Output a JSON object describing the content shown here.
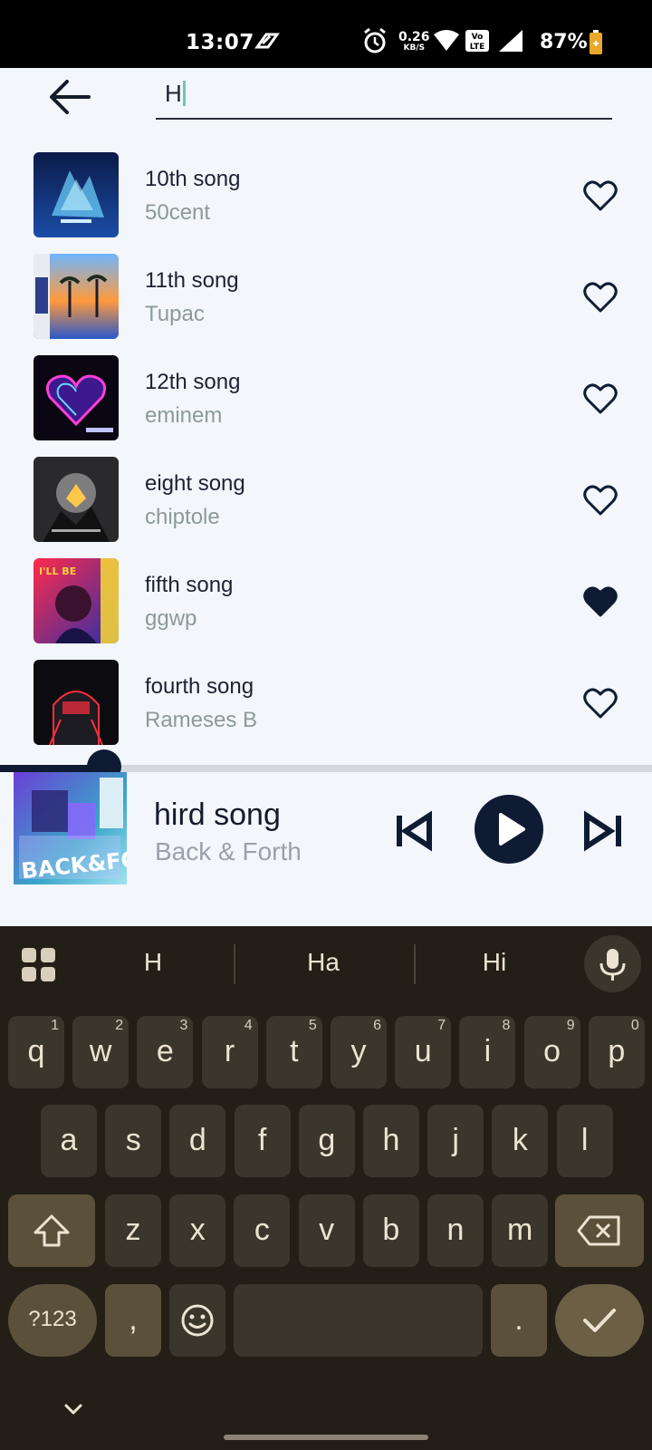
{
  "status_bar": {
    "time": "13:07",
    "net_speed_value": "0.26",
    "net_speed_unit": "KB/S",
    "battery": "87%"
  },
  "search": {
    "query": "H"
  },
  "songs": [
    {
      "title": "10th song",
      "artist": "50cent",
      "liked": false
    },
    {
      "title": "11th song",
      "artist": "Tupac",
      "liked": false
    },
    {
      "title": "12th song",
      "artist": "eminem",
      "liked": false
    },
    {
      "title": "eight song",
      "artist": "chiptole",
      "liked": false
    },
    {
      "title": "fifth song",
      "artist": "ggwp",
      "liked": true
    },
    {
      "title": "fourth song",
      "artist": "Rameses B",
      "liked": false
    }
  ],
  "player": {
    "title": "hird song",
    "artist": "Back & Forth",
    "progress": 0.16
  },
  "keyboard": {
    "suggestions": [
      "H",
      "Ha",
      "Hi"
    ],
    "row1": [
      {
        "k": "q",
        "n": "1"
      },
      {
        "k": "w",
        "n": "2"
      },
      {
        "k": "e",
        "n": "3"
      },
      {
        "k": "r",
        "n": "4"
      },
      {
        "k": "t",
        "n": "5"
      },
      {
        "k": "y",
        "n": "6"
      },
      {
        "k": "u",
        "n": "7"
      },
      {
        "k": "i",
        "n": "8"
      },
      {
        "k": "o",
        "n": "9"
      },
      {
        "k": "p",
        "n": "0"
      }
    ],
    "row2": [
      "a",
      "s",
      "d",
      "f",
      "g",
      "h",
      "j",
      "k",
      "l"
    ],
    "row3": [
      "z",
      "x",
      "c",
      "v",
      "b",
      "n",
      "m"
    ],
    "symbols_label": "?123",
    "comma": ",",
    "period": "."
  }
}
